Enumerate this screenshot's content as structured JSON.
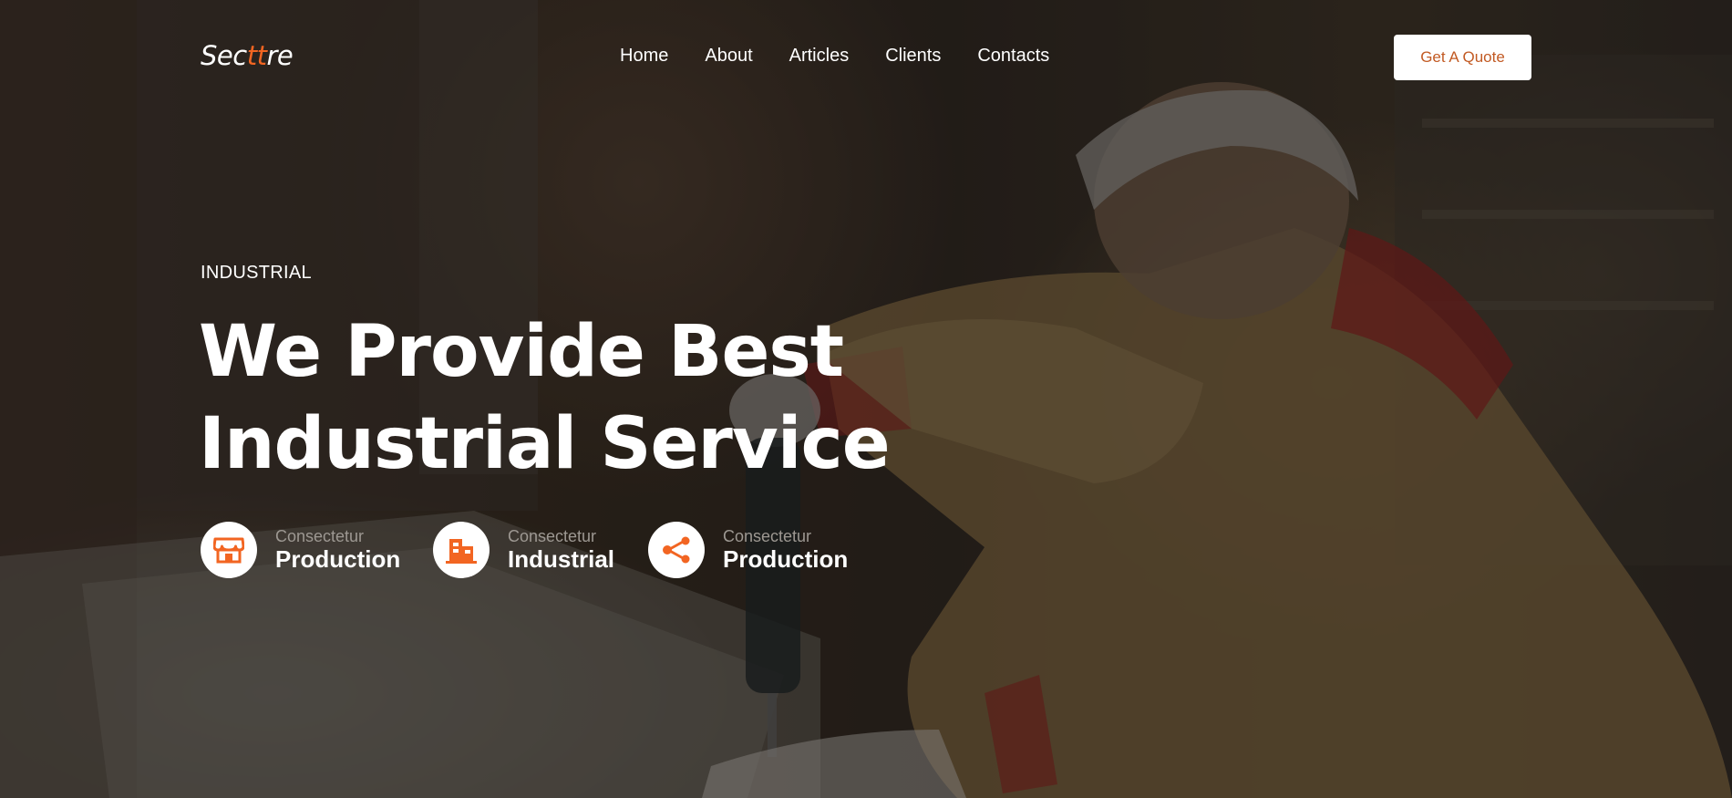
{
  "nav": {
    "logo": {
      "part1": "Sec",
      "accent": "tt",
      "part2": "re"
    },
    "links": [
      "Home",
      "About",
      "Articles",
      "Clients",
      "Contacts"
    ],
    "cta": "Get A Quote"
  },
  "hero": {
    "eyebrow": "INDUSTRIAL",
    "headline_line1": "We Provide Best",
    "headline_line2": "Industrial Service"
  },
  "features": [
    {
      "icon": "store-icon",
      "small": "Consectetur",
      "big": "Production"
    },
    {
      "icon": "building-icon",
      "small": "Consectetur",
      "big": "Industrial"
    },
    {
      "icon": "share-icon",
      "small": "Consectetur",
      "big": "Production"
    }
  ],
  "colors": {
    "accent": "#f26522",
    "button_text": "#c25a23",
    "muted": "#9d9892"
  }
}
